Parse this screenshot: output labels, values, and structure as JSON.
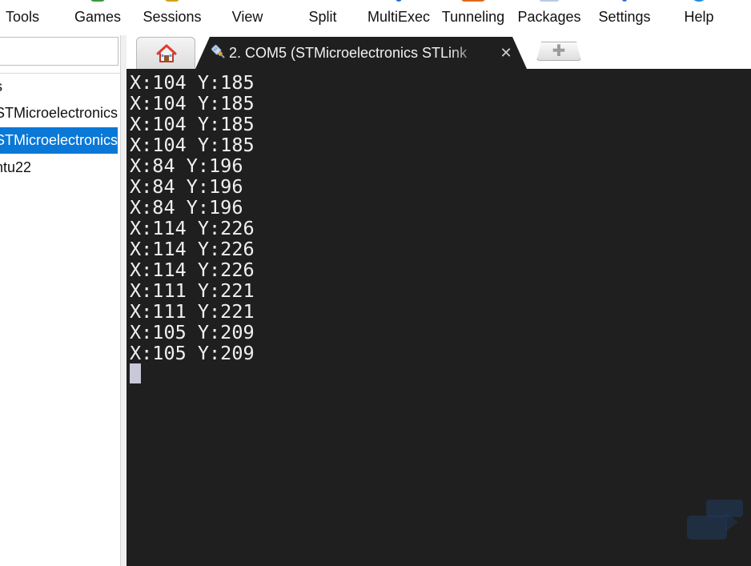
{
  "toolbar": {
    "items": [
      {
        "label": "Tools"
      },
      {
        "label": "Games"
      },
      {
        "label": "Sessions"
      },
      {
        "label": "View"
      },
      {
        "label": "Split"
      },
      {
        "label": "MultiExec"
      },
      {
        "label": "Tunneling"
      },
      {
        "label": "Packages"
      },
      {
        "label": "Settings"
      },
      {
        "label": "Help"
      }
    ]
  },
  "sidebar": {
    "quick_connect_value": "",
    "items": [
      {
        "label": "s"
      },
      {
        "label": "STMicroelectronics"
      },
      {
        "label": "STMicroelectronics"
      },
      {
        "label": "ntu22"
      }
    ],
    "selected_color": "#0a78d7"
  },
  "tabs": {
    "home_icon": "home-icon",
    "active_tab": {
      "icon": "serial-plug-icon",
      "title": "2. COM5  (STMicroelectronics STLink",
      "close_glyph": "✕"
    },
    "new_tab_glyph": "✚"
  },
  "terminal": {
    "background": "#1f1f1f",
    "foreground": "#f0f0f0",
    "lines": [
      "X:104 Y:185",
      "X:104 Y:185",
      "X:104 Y:185",
      "X:104 Y:185",
      "X:84 Y:196",
      "X:84 Y:196",
      "X:84 Y:196",
      "X:114 Y:226",
      "X:114 Y:226",
      "X:114 Y:226",
      "X:111 Y:221",
      "X:111 Y:221",
      "X:105 Y:209",
      "X:105 Y:209"
    ]
  }
}
